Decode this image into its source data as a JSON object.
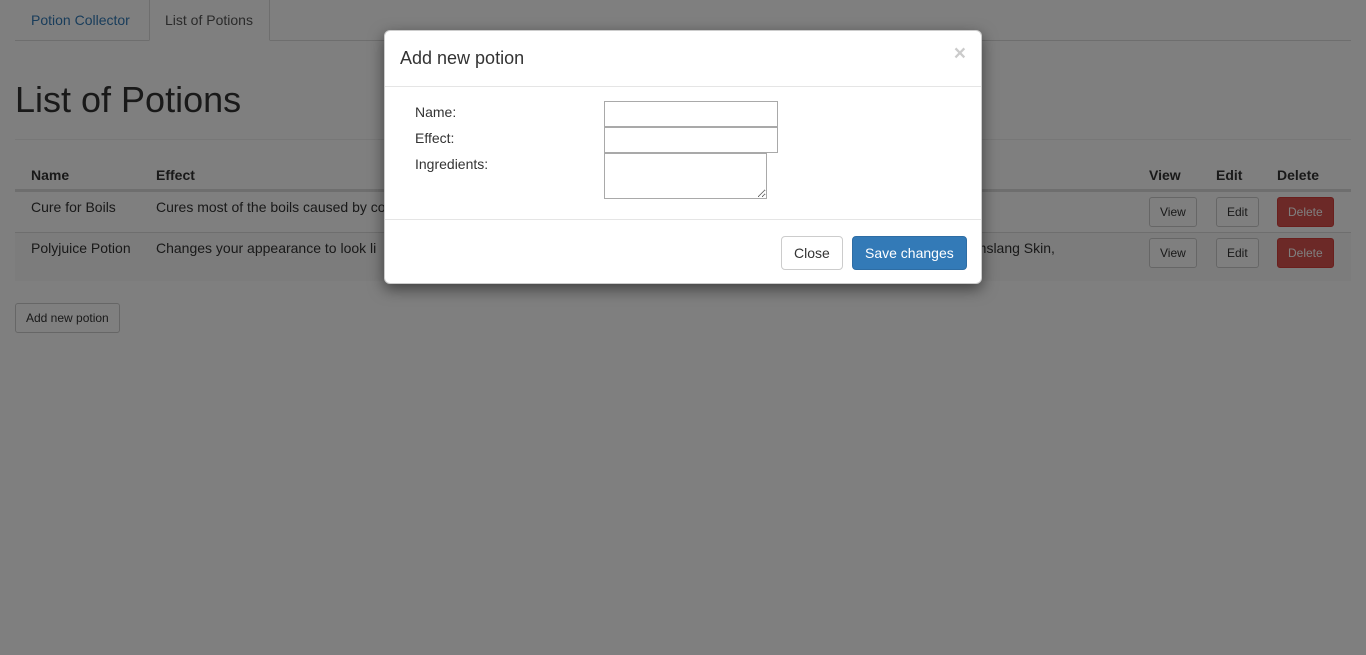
{
  "nav": {
    "brand": "Potion Collector",
    "active_tab": "List of Potions"
  },
  "page": {
    "title": "List of Potions",
    "add_button": "Add new potion"
  },
  "table": {
    "headers": {
      "name": "Name",
      "effect": "Effect",
      "view": "View",
      "edit": "Edit",
      "delete": "Delete"
    },
    "rows": [
      {
        "name": "Cure for Boils",
        "effect": "Cures most of the boils caused by co",
        "ingredients_tail": "",
        "view": "View",
        "edit": "Edit",
        "delete": "Delete"
      },
      {
        "name": "Polyjuice Potion",
        "effect": "Changes your appearance to look li",
        "ingredients_tail": "umslang Skin,",
        "view": "View",
        "edit": "Edit",
        "delete": "Delete"
      }
    ]
  },
  "modal": {
    "title": "Add new potion",
    "close_glyph": "×",
    "fields": {
      "name_label": "Name:",
      "name_value": "",
      "effect_label": "Effect:",
      "effect_value": "",
      "ingredients_label": "Ingredients:",
      "ingredients_value": ""
    },
    "footer": {
      "close_label": "Close",
      "save_label": "Save changes"
    }
  },
  "colors": {
    "link": "#337ab7",
    "primary": "#337ab7",
    "danger": "#d9534f"
  }
}
